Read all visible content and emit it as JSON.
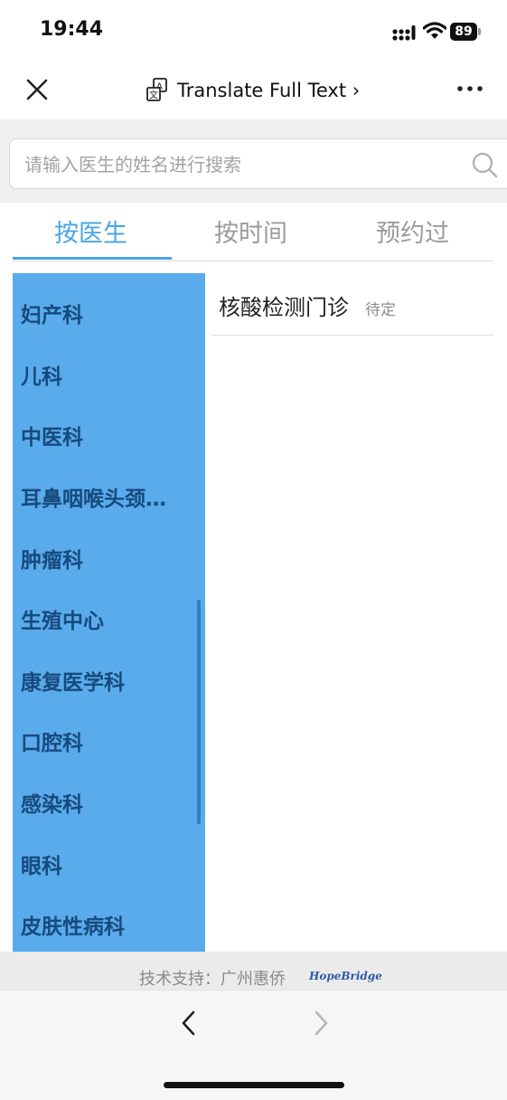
{
  "status_bar": {
    "time": "19:44",
    "battery": "89"
  },
  "nav": {
    "translate_label": "Translate Full Text ›"
  },
  "search": {
    "placeholder": "请输入医生的姓名进行搜索"
  },
  "tabs": [
    {
      "label": "按医生",
      "active": true
    },
    {
      "label": "按时间",
      "active": false
    },
    {
      "label": "预约过",
      "active": false
    }
  ],
  "departments": [
    "妇产科",
    "儿科",
    "中医科",
    "耳鼻咽喉头颈…",
    "肿瘤科",
    "生殖中心",
    "康复医学科",
    "口腔科",
    "感染科",
    "眼科",
    "皮肤性病科"
  ],
  "clinics": [
    {
      "name": "核酸检测门诊",
      "status": "待定"
    }
  ],
  "footer": {
    "text": "技术支持：广州惠侨",
    "logo": "HopeBridge"
  },
  "colors": {
    "accent": "#4aa4e6",
    "sidebar_bg": "#5aabeb",
    "sidebar_text": "#174a7e"
  }
}
